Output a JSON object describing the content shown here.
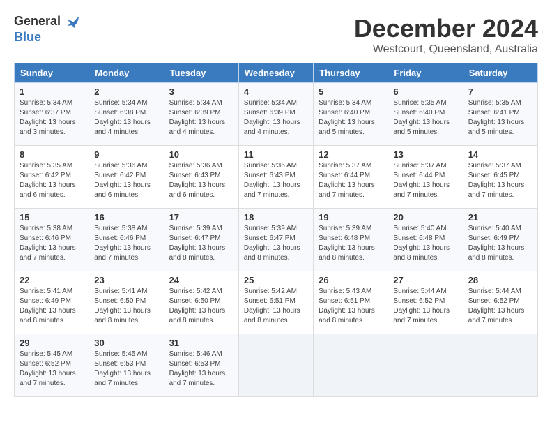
{
  "logo": {
    "general": "General",
    "blue": "Blue"
  },
  "title": "December 2024",
  "location": "Westcourt, Queensland, Australia",
  "days_of_week": [
    "Sunday",
    "Monday",
    "Tuesday",
    "Wednesday",
    "Thursday",
    "Friday",
    "Saturday"
  ],
  "weeks": [
    [
      {
        "day": "1",
        "sunrise": "5:34 AM",
        "sunset": "6:37 PM",
        "daylight": "13 hours and 3 minutes."
      },
      {
        "day": "2",
        "sunrise": "5:34 AM",
        "sunset": "6:38 PM",
        "daylight": "13 hours and 4 minutes."
      },
      {
        "day": "3",
        "sunrise": "5:34 AM",
        "sunset": "6:39 PM",
        "daylight": "13 hours and 4 minutes."
      },
      {
        "day": "4",
        "sunrise": "5:34 AM",
        "sunset": "6:39 PM",
        "daylight": "13 hours and 4 minutes."
      },
      {
        "day": "5",
        "sunrise": "5:34 AM",
        "sunset": "6:40 PM",
        "daylight": "13 hours and 5 minutes."
      },
      {
        "day": "6",
        "sunrise": "5:35 AM",
        "sunset": "6:40 PM",
        "daylight": "13 hours and 5 minutes."
      },
      {
        "day": "7",
        "sunrise": "5:35 AM",
        "sunset": "6:41 PM",
        "daylight": "13 hours and 5 minutes."
      }
    ],
    [
      {
        "day": "8",
        "sunrise": "5:35 AM",
        "sunset": "6:42 PM",
        "daylight": "13 hours and 6 minutes."
      },
      {
        "day": "9",
        "sunrise": "5:36 AM",
        "sunset": "6:42 PM",
        "daylight": "13 hours and 6 minutes."
      },
      {
        "day": "10",
        "sunrise": "5:36 AM",
        "sunset": "6:43 PM",
        "daylight": "13 hours and 6 minutes."
      },
      {
        "day": "11",
        "sunrise": "5:36 AM",
        "sunset": "6:43 PM",
        "daylight": "13 hours and 7 minutes."
      },
      {
        "day": "12",
        "sunrise": "5:37 AM",
        "sunset": "6:44 PM",
        "daylight": "13 hours and 7 minutes."
      },
      {
        "day": "13",
        "sunrise": "5:37 AM",
        "sunset": "6:44 PM",
        "daylight": "13 hours and 7 minutes."
      },
      {
        "day": "14",
        "sunrise": "5:37 AM",
        "sunset": "6:45 PM",
        "daylight": "13 hours and 7 minutes."
      }
    ],
    [
      {
        "day": "15",
        "sunrise": "5:38 AM",
        "sunset": "6:46 PM",
        "daylight": "13 hours and 7 minutes."
      },
      {
        "day": "16",
        "sunrise": "5:38 AM",
        "sunset": "6:46 PM",
        "daylight": "13 hours and 7 minutes."
      },
      {
        "day": "17",
        "sunrise": "5:39 AM",
        "sunset": "6:47 PM",
        "daylight": "13 hours and 8 minutes."
      },
      {
        "day": "18",
        "sunrise": "5:39 AM",
        "sunset": "6:47 PM",
        "daylight": "13 hours and 8 minutes."
      },
      {
        "day": "19",
        "sunrise": "5:39 AM",
        "sunset": "6:48 PM",
        "daylight": "13 hours and 8 minutes."
      },
      {
        "day": "20",
        "sunrise": "5:40 AM",
        "sunset": "6:48 PM",
        "daylight": "13 hours and 8 minutes."
      },
      {
        "day": "21",
        "sunrise": "5:40 AM",
        "sunset": "6:49 PM",
        "daylight": "13 hours and 8 minutes."
      }
    ],
    [
      {
        "day": "22",
        "sunrise": "5:41 AM",
        "sunset": "6:49 PM",
        "daylight": "13 hours and 8 minutes."
      },
      {
        "day": "23",
        "sunrise": "5:41 AM",
        "sunset": "6:50 PM",
        "daylight": "13 hours and 8 minutes."
      },
      {
        "day": "24",
        "sunrise": "5:42 AM",
        "sunset": "6:50 PM",
        "daylight": "13 hours and 8 minutes."
      },
      {
        "day": "25",
        "sunrise": "5:42 AM",
        "sunset": "6:51 PM",
        "daylight": "13 hours and 8 minutes."
      },
      {
        "day": "26",
        "sunrise": "5:43 AM",
        "sunset": "6:51 PM",
        "daylight": "13 hours and 8 minutes."
      },
      {
        "day": "27",
        "sunrise": "5:44 AM",
        "sunset": "6:52 PM",
        "daylight": "13 hours and 7 minutes."
      },
      {
        "day": "28",
        "sunrise": "5:44 AM",
        "sunset": "6:52 PM",
        "daylight": "13 hours and 7 minutes."
      }
    ],
    [
      {
        "day": "29",
        "sunrise": "5:45 AM",
        "sunset": "6:52 PM",
        "daylight": "13 hours and 7 minutes."
      },
      {
        "day": "30",
        "sunrise": "5:45 AM",
        "sunset": "6:53 PM",
        "daylight": "13 hours and 7 minutes."
      },
      {
        "day": "31",
        "sunrise": "5:46 AM",
        "sunset": "6:53 PM",
        "daylight": "13 hours and 7 minutes."
      },
      null,
      null,
      null,
      null
    ]
  ],
  "labels": {
    "sunrise": "Sunrise:",
    "sunset": "Sunset:",
    "daylight": "Daylight:"
  }
}
